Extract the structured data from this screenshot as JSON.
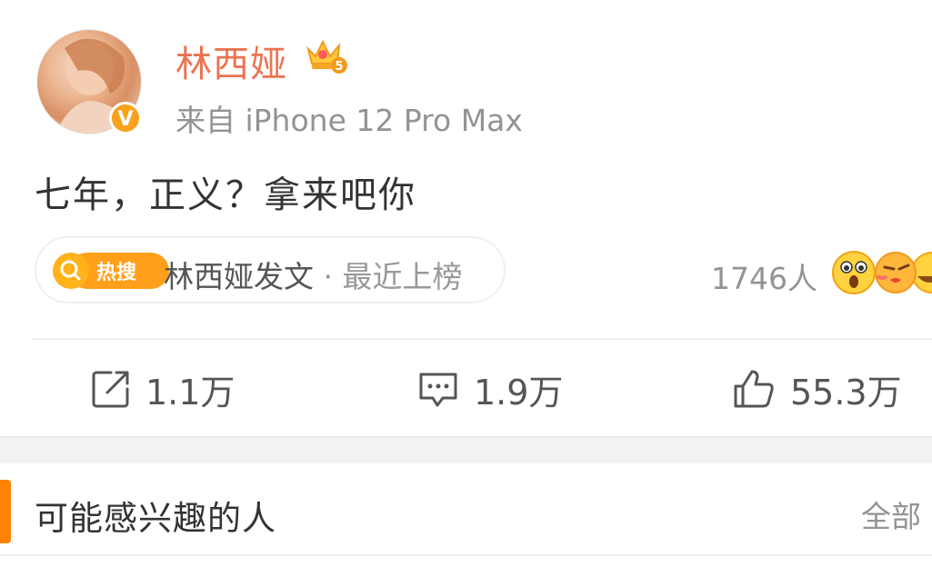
{
  "post": {
    "username": "林西娅",
    "source": "来自 iPhone 12 Pro Max",
    "text": "七年，正义？拿来吧你",
    "verified_mark": "V",
    "crown_level": "5",
    "hot": {
      "badge_label": "热搜",
      "topic": "林西娅发文",
      "separator": " · ",
      "rank": "最近上榜"
    },
    "reaction_count": "1746人",
    "actions": {
      "repost": "1.1万",
      "comment": "1.9万",
      "like": "55.3万"
    }
  },
  "recommend": {
    "title": "可能感兴趣的人",
    "all": "全部"
  },
  "colors": {
    "username": "#eb7350",
    "accent": "#ff8200",
    "verified": "#f9a11b",
    "gray_text": "#939393"
  },
  "icons": [
    "verified-icon",
    "crown-icon",
    "hot-search-icon",
    "repost-icon",
    "comment-icon",
    "like-icon",
    "emoji-shocked-icon",
    "emoji-kiss-icon",
    "emoji-laugh-icon"
  ]
}
